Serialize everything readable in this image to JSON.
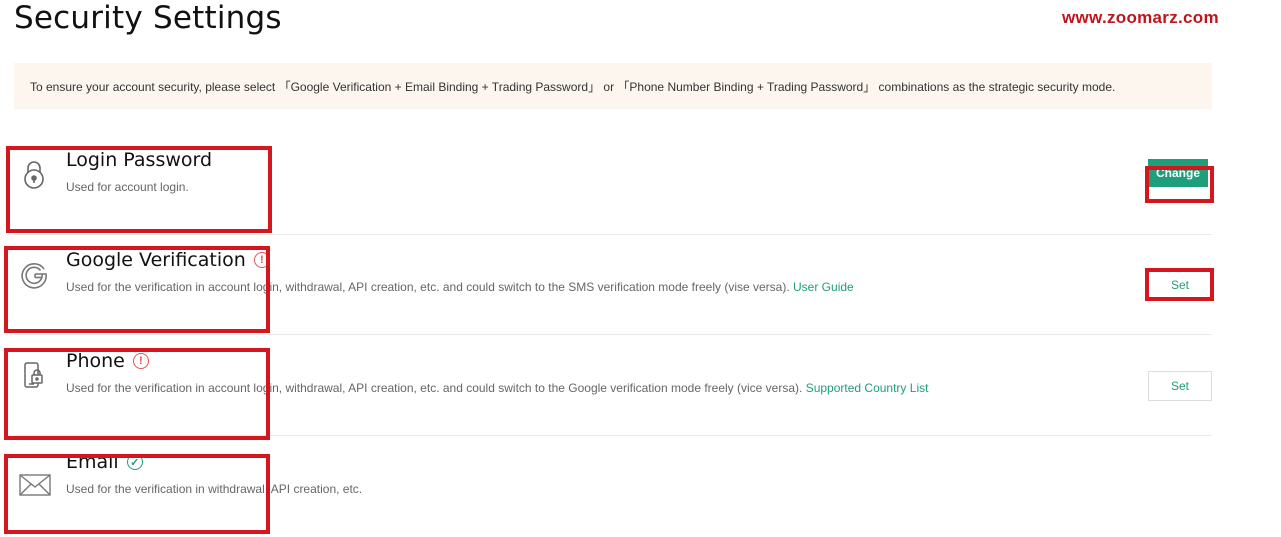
{
  "page": {
    "title": "Security Settings",
    "watermark": "www.zoomarz.com"
  },
  "notice": {
    "text": "To ensure your account security, please select 「Google Verification + Email Binding + Trading Password」 or 「Phone Number Binding + Trading Password」 combinations as the strategic security mode."
  },
  "items": [
    {
      "icon": "padlock-icon",
      "title": "Login Password",
      "description": "Used for account login.",
      "status": "",
      "link": "",
      "button": "Change"
    },
    {
      "icon": "google-g-icon",
      "title": "Google Verification",
      "description": "Used for the verification in account login, withdrawal, API creation, etc. and could switch to the SMS verification mode freely (vise versa).",
      "status": "warning",
      "status_glyph": "!",
      "link": "User Guide",
      "button": "Set"
    },
    {
      "icon": "phone-lock-icon",
      "title": "Phone",
      "description": "Used for the verification in account login, withdrawal, API creation, etc. and could switch to the Google verification mode freely (vice versa).",
      "status": "warning",
      "status_glyph": "!",
      "link": "Supported Country List",
      "button": "Set"
    },
    {
      "icon": "envelope-icon",
      "title": "Email",
      "description": "Used for the verification in withdrawal, API creation, etc.",
      "status": "ok",
      "status_glyph": "✓",
      "link": "",
      "button": ""
    }
  ],
  "colors": {
    "accent": "#1f9e7c",
    "warning": "#e05555",
    "notice_bg": "#fdf6ef",
    "highlight": "#d4161e"
  }
}
